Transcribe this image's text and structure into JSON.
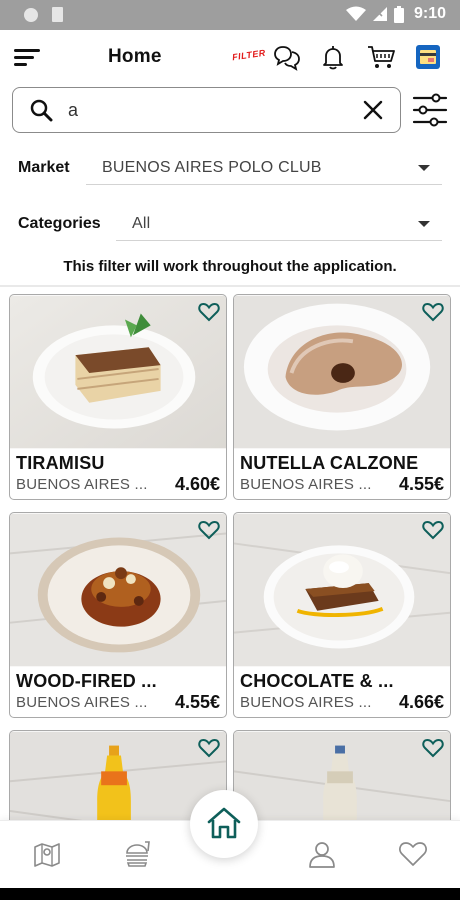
{
  "status_bar": {
    "time": "9:10"
  },
  "header": {
    "title": "Home",
    "filter_tag": "FILTER"
  },
  "search": {
    "value": "a",
    "placeholder": ""
  },
  "filters": {
    "market_label": "Market",
    "market_value": "BUENOS AIRES POLO CLUB",
    "categories_label": "Categories",
    "categories_value": "All"
  },
  "note": "This filter will work throughout the application.",
  "products": [
    {
      "name": "TIRAMISU",
      "location": "BUENOS AIRES ...",
      "price": "4.60€"
    },
    {
      "name": "NUTELLA CALZONE",
      "location": "BUENOS AIRES ...",
      "price": "4.55€"
    },
    {
      "name": "WOOD-FIRED ...",
      "location": "BUENOS AIRES ...",
      "price": "4.55€"
    },
    {
      "name": "CHOCOLATE & ...",
      "location": "BUENOS AIRES ...",
      "price": "4.66€"
    }
  ],
  "colors": {
    "accent": "#0e5f5a",
    "filter_tag": "#e21b1b",
    "brand_icon": "#1565c0"
  },
  "icons": [
    "menu-icon",
    "chat-icon",
    "bell-icon",
    "cart-icon",
    "wallet-icon",
    "search-icon",
    "close-icon",
    "tune-icon",
    "heart-icon",
    "map-icon",
    "food-icon",
    "home-icon",
    "user-icon"
  ]
}
